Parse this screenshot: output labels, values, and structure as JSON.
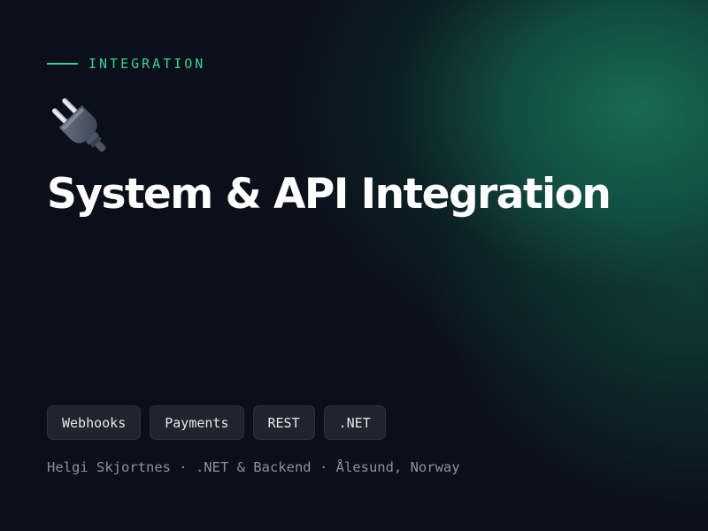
{
  "eyebrow": {
    "label": "INTEGRATION",
    "accent_color": "#34d399"
  },
  "hero_icon": "electric-plug-icon",
  "title": "System & API Integration",
  "tags": [
    {
      "label": "Webhooks"
    },
    {
      "label": "Payments"
    },
    {
      "label": "REST"
    },
    {
      "label": ".NET"
    }
  ],
  "footer": {
    "text": "Helgi Skjortnes · .NET & Backend · Ålesund, Norway"
  },
  "colors": {
    "background": "#0b0f1a",
    "glow": "#186e58",
    "title": "#ffffff",
    "muted": "#8b919e"
  }
}
